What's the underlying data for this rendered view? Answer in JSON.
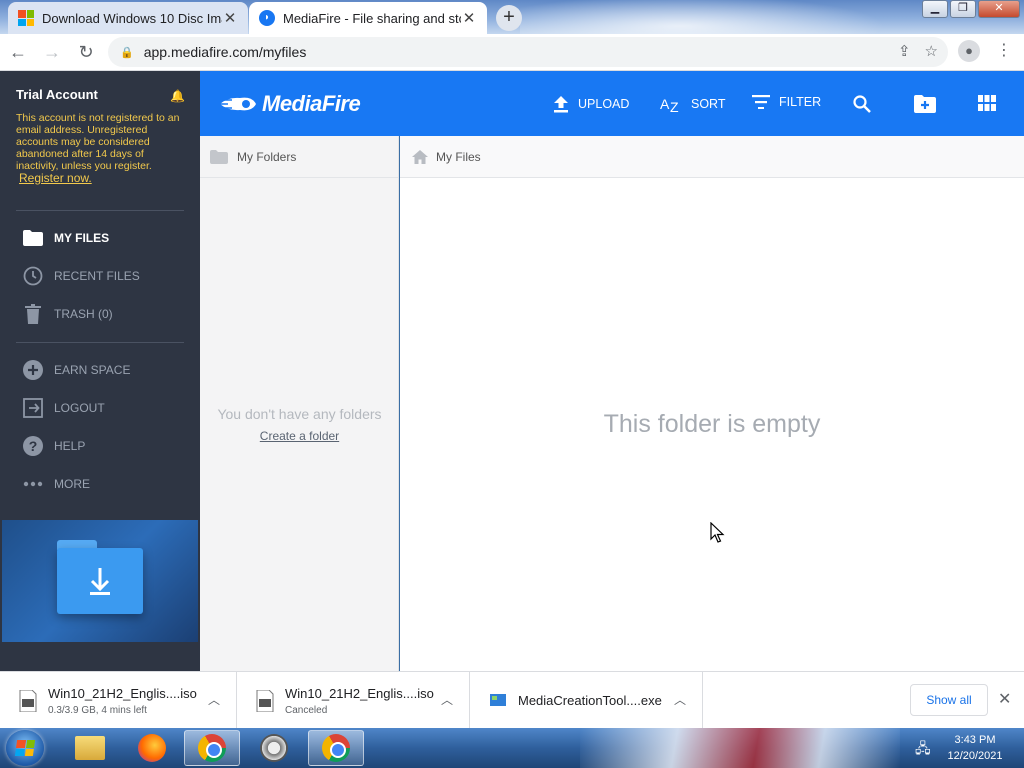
{
  "browser": {
    "tabs": [
      {
        "title": "Download Windows 10 Disc Imag",
        "favicon": "microsoft-logo-icon"
      },
      {
        "title": "MediaFire - File sharing and stor",
        "favicon": "mediafire-icon"
      }
    ],
    "url": "app.mediafire.com/myfiles"
  },
  "sidebar": {
    "account_title": "Trial Account",
    "account_message": "This account is not registered to an email address. Unregistered accounts may be considered abandoned after 14 days of inactivity, unless you register.",
    "register_link": "Register now.",
    "nav_main": [
      {
        "label": "MY FILES",
        "icon": "folder-icon"
      },
      {
        "label": "RECENT FILES",
        "icon": "clock-icon"
      },
      {
        "label": "TRASH (0)",
        "icon": "trash-icon"
      }
    ],
    "nav_secondary": [
      {
        "label": "EARN SPACE",
        "icon": "plus-circle-icon"
      },
      {
        "label": "LOGOUT",
        "icon": "logout-icon"
      },
      {
        "label": "HELP",
        "icon": "help-icon"
      },
      {
        "label": "MORE",
        "icon": "more-icon"
      }
    ]
  },
  "header": {
    "logo": "MediaFire",
    "upload": "UPLOAD",
    "sort": "SORT",
    "filter": "FILTER"
  },
  "folders_panel": {
    "title": "My Folders",
    "empty_text": "You don't have any folders",
    "create_link": "Create a folder"
  },
  "files_panel": {
    "breadcrumb": "My Files",
    "empty_text": "This folder is empty"
  },
  "downloads": [
    {
      "name": "Win10_21H2_Englis....iso",
      "status": "0.3/3.9 GB, 4 mins left"
    },
    {
      "name": "Win10_21H2_Englis....iso",
      "status": "Canceled"
    },
    {
      "name": "MediaCreationTool....exe",
      "status": ""
    }
  ],
  "download_bar": {
    "show_all": "Show all"
  },
  "taskbar": {
    "time": "3:43 PM",
    "date": "12/20/2021"
  },
  "colors": {
    "brand": "#1878f3",
    "sidebar": "#2e3543",
    "warning": "#f2c94c"
  }
}
